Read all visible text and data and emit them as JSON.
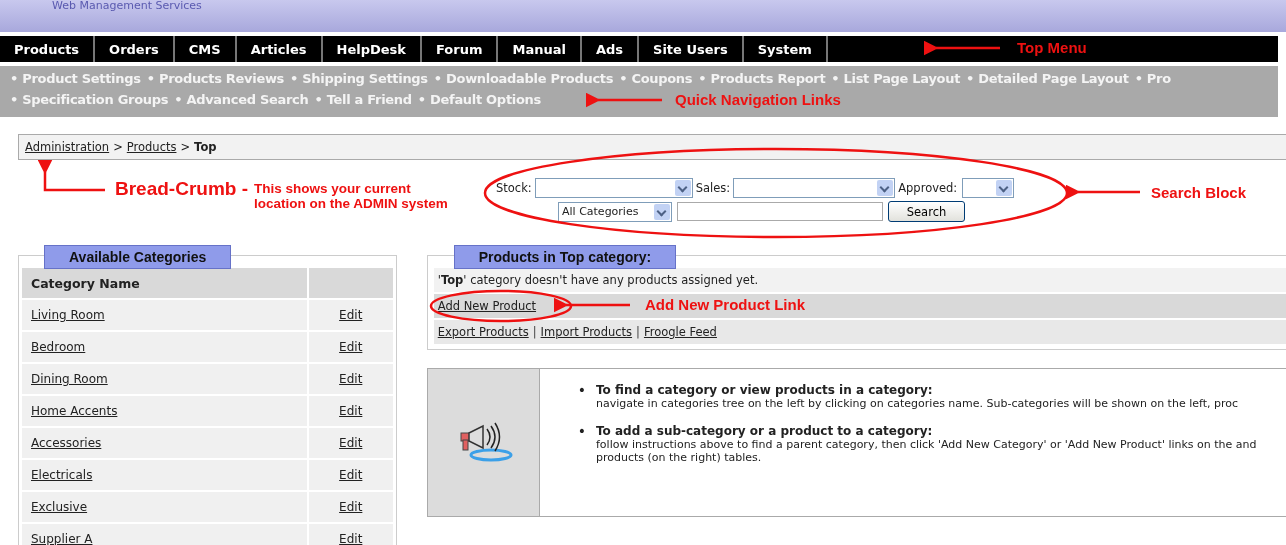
{
  "header": {
    "title": "Web Management Services"
  },
  "top_menu": [
    {
      "label": "Products"
    },
    {
      "label": "Orders"
    },
    {
      "label": "CMS"
    },
    {
      "label": "Articles"
    },
    {
      "label": "HelpDesk"
    },
    {
      "label": "Forum"
    },
    {
      "label": "Manual"
    },
    {
      "label": "Ads"
    },
    {
      "label": "Site Users"
    },
    {
      "label": "System"
    }
  ],
  "quick_links": {
    "bullet": "•",
    "rows": [
      [
        "Product Settings",
        "Products Reviews",
        "Shipping Settings",
        "Downloadable Products",
        "Coupons",
        "Products Report",
        "List Page Layout",
        "Detailed Page Layout",
        "Pro"
      ],
      [
        "Specification Groups",
        "Advanced Search",
        "Tell a Friend",
        "Default Options"
      ]
    ]
  },
  "breadcrumb": {
    "links": [
      "Administration",
      "Products"
    ],
    "separator": ">",
    "current": "Top"
  },
  "search": {
    "stock_label": "Stock:",
    "sales_label": "Sales:",
    "approved_label": "Approved:",
    "category_select": "All Categories",
    "button": "Search"
  },
  "categories": {
    "title": "Available Categories",
    "column": "Category Name",
    "rows": [
      {
        "name": "Living Room",
        "action": "Edit"
      },
      {
        "name": "Bedroom",
        "action": "Edit"
      },
      {
        "name": "Dining Room",
        "action": "Edit"
      },
      {
        "name": "Home Accents",
        "action": "Edit"
      },
      {
        "name": "Accessories",
        "action": "Edit"
      },
      {
        "name": "Electricals",
        "action": "Edit"
      },
      {
        "name": "Exclusive",
        "action": "Edit"
      },
      {
        "name": "Supplier A",
        "action": "Edit"
      }
    ]
  },
  "products": {
    "title": "Products in Top category:",
    "message": "'**Top**' category doesn't have any products assigned yet.",
    "add_link": "Add New Product",
    "links": [
      "Export Products",
      "Import Products",
      "Froogle Feed"
    ],
    "link_separator": "|"
  },
  "tips": {
    "bullet": "•",
    "items": [
      {
        "heading": "To find a category or view products in a category:",
        "text": "navigate in categories tree on the left by clicking on categories name. Sub-categories will be shown on the left, proc"
      },
      {
        "heading": "To add a sub-category or a product to a category:",
        "text": "follow instructions above to find a parent category, then click 'Add New Category' or 'Add New Product' links on the and products (on the right) tables."
      }
    ]
  },
  "annotations": {
    "top_menu": "Top Menu",
    "quick_links": "Quick Navigation Links",
    "breadcrumb_title": "Bread-Crumb -",
    "breadcrumb_note": "This shows your current location on the ADMIN system",
    "search": "Search Block",
    "add_product": "Add New  Product Link"
  }
}
